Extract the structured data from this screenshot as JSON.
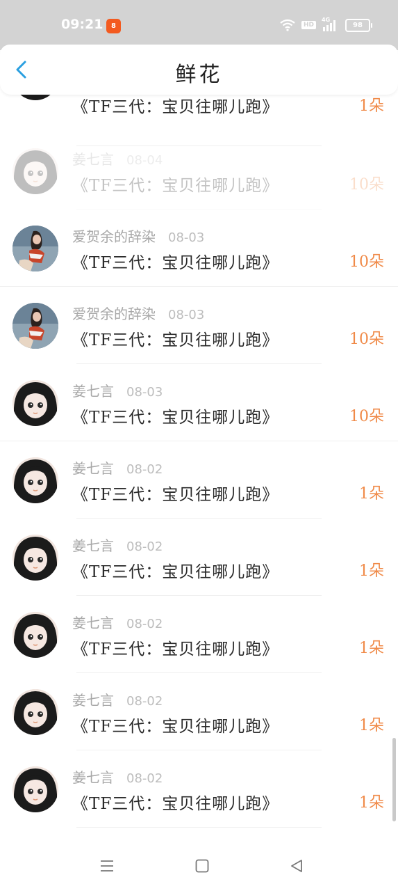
{
  "status_bar": {
    "time": "09:21",
    "app_icon_text": "8",
    "network_label": "HD",
    "signal_label": "4G",
    "battery": "98"
  },
  "header": {
    "title": "鲜花"
  },
  "items": [
    {
      "sender": "",
      "date": "",
      "title": "《TF三代：宝贝往哪儿跑》",
      "count": "1朵",
      "avatar": "girl"
    },
    {
      "sender": "姜七言",
      "date": "08-04",
      "title": "《TF三代：宝贝往哪儿跑》",
      "count": "10朵",
      "avatar": "girl"
    },
    {
      "sender": "爱贺余的辞染",
      "date": "08-03",
      "title": "《TF三代：宝贝往哪儿跑》",
      "count": "10朵",
      "avatar": "photo"
    },
    {
      "sender": "爱贺余的辞染",
      "date": "08-03",
      "title": "《TF三代：宝贝往哪儿跑》",
      "count": "10朵",
      "avatar": "photo"
    },
    {
      "sender": "姜七言",
      "date": "08-03",
      "title": "《TF三代：宝贝往哪儿跑》",
      "count": "10朵",
      "avatar": "girl"
    },
    {
      "sender": "姜七言",
      "date": "08-02",
      "title": "《TF三代：宝贝往哪儿跑》",
      "count": "1朵",
      "avatar": "girl"
    },
    {
      "sender": "姜七言",
      "date": "08-02",
      "title": "《TF三代：宝贝往哪儿跑》",
      "count": "1朵",
      "avatar": "girl"
    },
    {
      "sender": "姜七言",
      "date": "08-02",
      "title": "《TF三代：宝贝往哪儿跑》",
      "count": "1朵",
      "avatar": "girl"
    },
    {
      "sender": "姜七言",
      "date": "08-02",
      "title": "《TF三代：宝贝往哪儿跑》",
      "count": "1朵",
      "avatar": "girl"
    },
    {
      "sender": "姜七言",
      "date": "08-02",
      "title": "《TF三代：宝贝往哪儿跑》",
      "count": "1朵",
      "avatar": "girl"
    }
  ],
  "colors": {
    "accent_blue": "#2a9fe0",
    "count_orange": "#f08a48",
    "status_bar_bg": "#d3d3d3"
  },
  "icons": {
    "back": "chevron-left-icon",
    "nav_menu": "menu-icon",
    "nav_home": "home-square-icon",
    "nav_back": "triangle-back-icon"
  }
}
